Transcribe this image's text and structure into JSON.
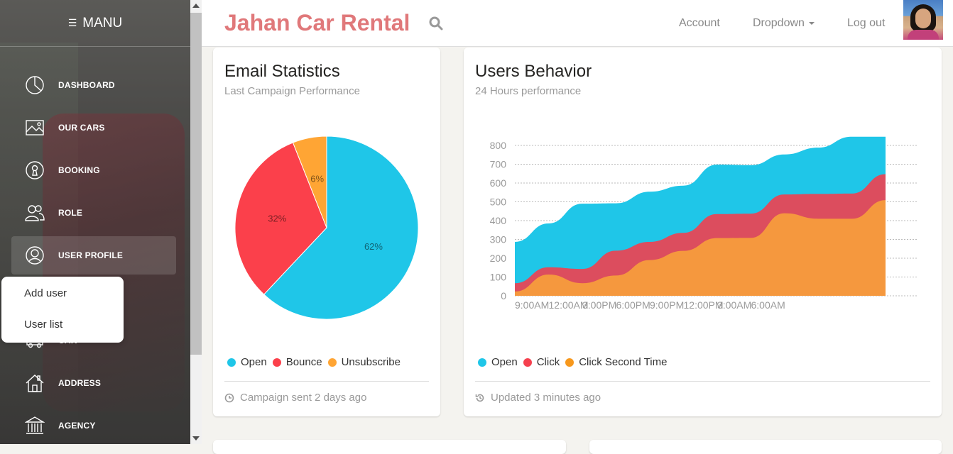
{
  "sidebar": {
    "title": "MANU",
    "items": [
      {
        "label": "DASHBOARD",
        "icon": "pie-chart-icon"
      },
      {
        "label": "OUR CARS",
        "icon": "image-icon"
      },
      {
        "label": "BOOKING",
        "icon": "keyhole-icon"
      },
      {
        "label": "ROLE",
        "icon": "users-icon"
      },
      {
        "label": "USER PROFILE",
        "icon": "user-circle-icon",
        "active": true
      },
      {
        "label": "CAR",
        "icon": "car-icon"
      },
      {
        "label": "ADDRESS",
        "icon": "home-icon"
      },
      {
        "label": "AGENCY",
        "icon": "bank-icon"
      }
    ],
    "submenu": [
      "Add user",
      "User list"
    ]
  },
  "topbar": {
    "brand": "Jahan Car Rental",
    "links": {
      "account": "Account",
      "dropdown": "Dropdown",
      "logout": "Log out"
    }
  },
  "email_card": {
    "title": "Email Statistics",
    "subtitle": "Last Campaign Performance",
    "legend": [
      "Open",
      "Bounce",
      "Unsubscribe"
    ],
    "footer": "Campaign sent 2 days ago"
  },
  "users_card": {
    "title": "Users Behavior",
    "subtitle": "24 Hours performance",
    "legend": [
      "Open",
      "Click",
      "Click Second Time"
    ],
    "footer": "Updated 3 minutes ago"
  },
  "colors": {
    "cyan": "#1fc6e8",
    "red": "#f5404e",
    "orange": "#f7981c",
    "brand": "#e0787a"
  },
  "chart_data": [
    {
      "type": "pie",
      "categories": [
        "Open",
        "Bounce",
        "Unsubscribe"
      ],
      "values": [
        62,
        32,
        6
      ],
      "labels": [
        "62%",
        "32%",
        "6%"
      ],
      "colors": [
        "#1fc6e8",
        "#fb404b",
        "#ffa534"
      ]
    },
    {
      "type": "area",
      "x_ticks": [
        "9:00AM",
        "12:00AM",
        "3:00PM",
        "6:00PM",
        "9:00PM",
        "12:00PM",
        "3:00AM",
        "6:00AM"
      ],
      "y_ticks": [
        "0",
        "100",
        "200",
        "300",
        "400",
        "500",
        "600",
        "700",
        "800"
      ],
      "ylim": [
        0,
        800
      ],
      "grid": true,
      "x": [
        0,
        1,
        2,
        3,
        4,
        5,
        6,
        7,
        8,
        9,
        10,
        11
      ],
      "series": [
        {
          "name": "Open",
          "color": "#1fc6e8",
          "values": [
            287,
            385,
            490,
            492,
            554,
            586,
            698,
            695,
            752,
            788,
            846,
            846
          ]
        },
        {
          "name": "Click",
          "color": "#dc4d5e",
          "values": [
            67,
            152,
            143,
            240,
            287,
            335,
            435,
            437,
            539,
            542,
            544,
            647
          ]
        },
        {
          "name": "Click Second Time",
          "color": "#f5983e",
          "values": [
            23,
            113,
            67,
            108,
            190,
            239,
            307,
            308,
            439,
            410,
            410,
            509
          ]
        }
      ]
    }
  ]
}
